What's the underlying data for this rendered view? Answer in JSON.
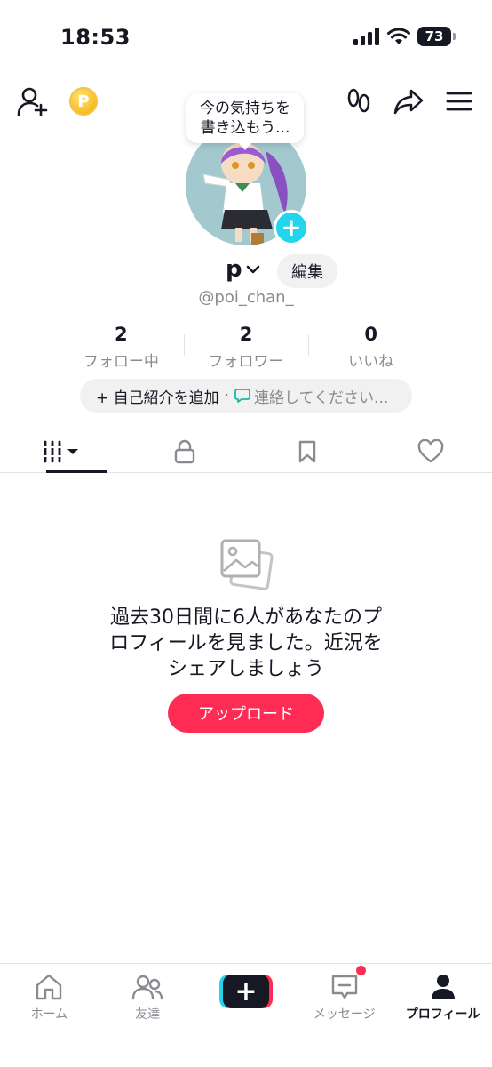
{
  "status_bar": {
    "time": "18:53",
    "battery": "73"
  },
  "top_bar": {
    "coin_letter": "P"
  },
  "profile": {
    "note_bubble": [
      "今の気持ちを",
      "書き込もう..."
    ],
    "username": "p",
    "edit_label": "編集",
    "handle": "@poi_chan_"
  },
  "stats": [
    {
      "value": "2",
      "label": "フォロー中"
    },
    {
      "value": "2",
      "label": "フォロワー"
    },
    {
      "value": "0",
      "label": "いいね"
    }
  ],
  "bio_bar": {
    "add_label": "+ 自己紹介を追加",
    "separator": "·",
    "contact_label": "連絡してください..."
  },
  "empty_state": {
    "message_lines": [
      "過去30日間に6人があなたのプ",
      "ロフィールを見ました。近況を",
      "シェアしましょう"
    ],
    "upload_label": "アップロード"
  },
  "bottom_nav": [
    {
      "label": "ホーム",
      "icon": "home-icon"
    },
    {
      "label": "友達",
      "icon": "friends-icon"
    },
    {
      "label": "",
      "icon": "create-icon"
    },
    {
      "label": "メッセージ",
      "icon": "inbox-icon"
    },
    {
      "label": "プロフィール",
      "icon": "profile-icon"
    }
  ],
  "colors": {
    "accent": "#fe2c55",
    "cyan": "#20d5ec",
    "text": "#161823",
    "muted": "#8a8b91"
  }
}
